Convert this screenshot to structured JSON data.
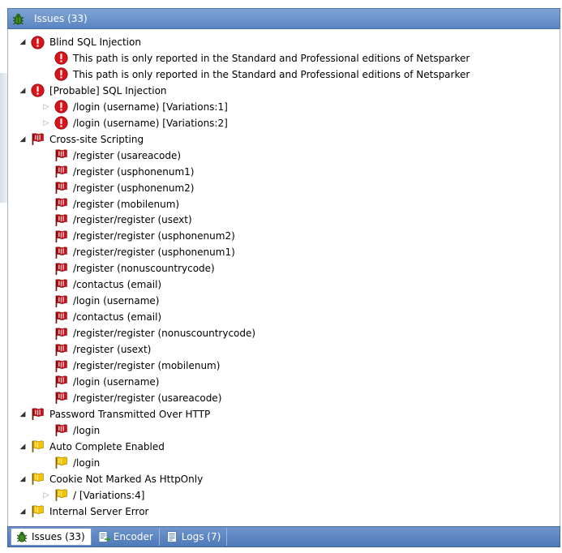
{
  "panel": {
    "title": "Issues (33)",
    "title_icon": "bug-icon"
  },
  "colors": {
    "header_blue": "#5b86c4",
    "critical_red": "#d8141a",
    "flag_red": "#c8101a",
    "flag_yellow": "#f2c400"
  },
  "tree": [
    {
      "level": 0,
      "expander": "expanded",
      "icon": "critical-icon",
      "label": "Blind SQL Injection"
    },
    {
      "level": 1,
      "expander": "none",
      "icon": "critical-icon",
      "label": "This path is only reported in the Standard and Professional editions of Netsparker"
    },
    {
      "level": 1,
      "expander": "none",
      "icon": "critical-icon",
      "label": "This path is only reported in the Standard and Professional editions of Netsparker"
    },
    {
      "level": 0,
      "expander": "expanded",
      "icon": "critical-icon",
      "label": "[Probable] SQL Injection"
    },
    {
      "level": 1,
      "expander": "collapsed",
      "icon": "critical-icon",
      "label": "/login (username) [Variations:1]"
    },
    {
      "level": 1,
      "expander": "collapsed",
      "icon": "critical-icon",
      "label": "/login (username) [Variations:2]"
    },
    {
      "level": 0,
      "expander": "expanded",
      "icon": "red-flag-icon",
      "label": "Cross-site Scripting"
    },
    {
      "level": 1,
      "expander": "none",
      "icon": "red-flag-icon",
      "label": "/register (usareacode)"
    },
    {
      "level": 1,
      "expander": "none",
      "icon": "red-flag-icon",
      "label": "/register (usphonenum1)"
    },
    {
      "level": 1,
      "expander": "none",
      "icon": "red-flag-icon",
      "label": "/register (usphonenum2)"
    },
    {
      "level": 1,
      "expander": "none",
      "icon": "red-flag-icon",
      "label": "/register (mobilenum)"
    },
    {
      "level": 1,
      "expander": "none",
      "icon": "red-flag-icon",
      "label": "/register/register (usext)"
    },
    {
      "level": 1,
      "expander": "none",
      "icon": "red-flag-icon",
      "label": "/register/register (usphonenum2)"
    },
    {
      "level": 1,
      "expander": "none",
      "icon": "red-flag-icon",
      "label": "/register/register (usphonenum1)"
    },
    {
      "level": 1,
      "expander": "none",
      "icon": "red-flag-icon",
      "label": "/register (nonuscountrycode)"
    },
    {
      "level": 1,
      "expander": "none",
      "icon": "red-flag-icon",
      "label": "/contactus (email)"
    },
    {
      "level": 1,
      "expander": "none",
      "icon": "red-flag-icon",
      "label": "/login (username)"
    },
    {
      "level": 1,
      "expander": "none",
      "icon": "red-flag-icon",
      "label": "/contactus (email)"
    },
    {
      "level": 1,
      "expander": "none",
      "icon": "red-flag-icon",
      "label": "/register/register (nonuscountrycode)"
    },
    {
      "level": 1,
      "expander": "none",
      "icon": "red-flag-icon",
      "label": "/register (usext)"
    },
    {
      "level": 1,
      "expander": "none",
      "icon": "red-flag-icon",
      "label": "/register/register (mobilenum)"
    },
    {
      "level": 1,
      "expander": "none",
      "icon": "red-flag-icon",
      "label": "/login (username)"
    },
    {
      "level": 1,
      "expander": "none",
      "icon": "red-flag-icon",
      "label": "/register/register (usareacode)"
    },
    {
      "level": 0,
      "expander": "expanded",
      "icon": "red-flag-icon",
      "label": "Password Transmitted Over HTTP"
    },
    {
      "level": 1,
      "expander": "none",
      "icon": "red-flag-icon",
      "label": "/login"
    },
    {
      "level": 0,
      "expander": "expanded",
      "icon": "yellow-flag-icon",
      "label": "Auto Complete Enabled"
    },
    {
      "level": 1,
      "expander": "none",
      "icon": "yellow-flag-icon",
      "label": "/login"
    },
    {
      "level": 0,
      "expander": "expanded",
      "icon": "yellow-flag-icon",
      "label": "Cookie Not Marked As HttpOnly"
    },
    {
      "level": 1,
      "expander": "collapsed",
      "icon": "yellow-flag-icon",
      "label": "/  [Variations:4]"
    },
    {
      "level": 0,
      "expander": "expanded",
      "icon": "yellow-flag-icon",
      "label": "Internal Server Error"
    }
  ],
  "tabs": [
    {
      "label": "Issues (33)",
      "icon": "bug-icon",
      "active": true
    },
    {
      "label": "Encoder",
      "icon": "encoder-icon",
      "active": false
    },
    {
      "label": "Logs (7)",
      "icon": "logs-icon",
      "active": false
    }
  ]
}
